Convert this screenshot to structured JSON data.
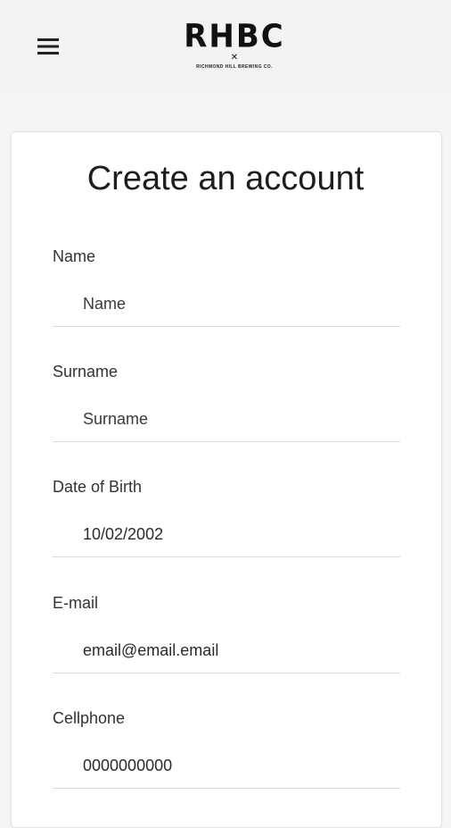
{
  "header": {
    "menu_icon": "hamburger-menu-icon",
    "logo": {
      "mark": "RHBC",
      "tagline": "RICHMOND HILL BREWING CO.",
      "separator": "✕"
    }
  },
  "form": {
    "title": "Create an account",
    "fields": [
      {
        "label": "Name",
        "placeholder": "Name",
        "value": ""
      },
      {
        "label": "Surname",
        "placeholder": "Surname",
        "value": ""
      },
      {
        "label": "Date of Birth",
        "placeholder": "",
        "value": "10/02/2002"
      },
      {
        "label": "E-mail",
        "placeholder": "",
        "value": "email@email.email"
      },
      {
        "label": "Cellphone",
        "placeholder": "",
        "value": "0000000000"
      }
    ]
  }
}
